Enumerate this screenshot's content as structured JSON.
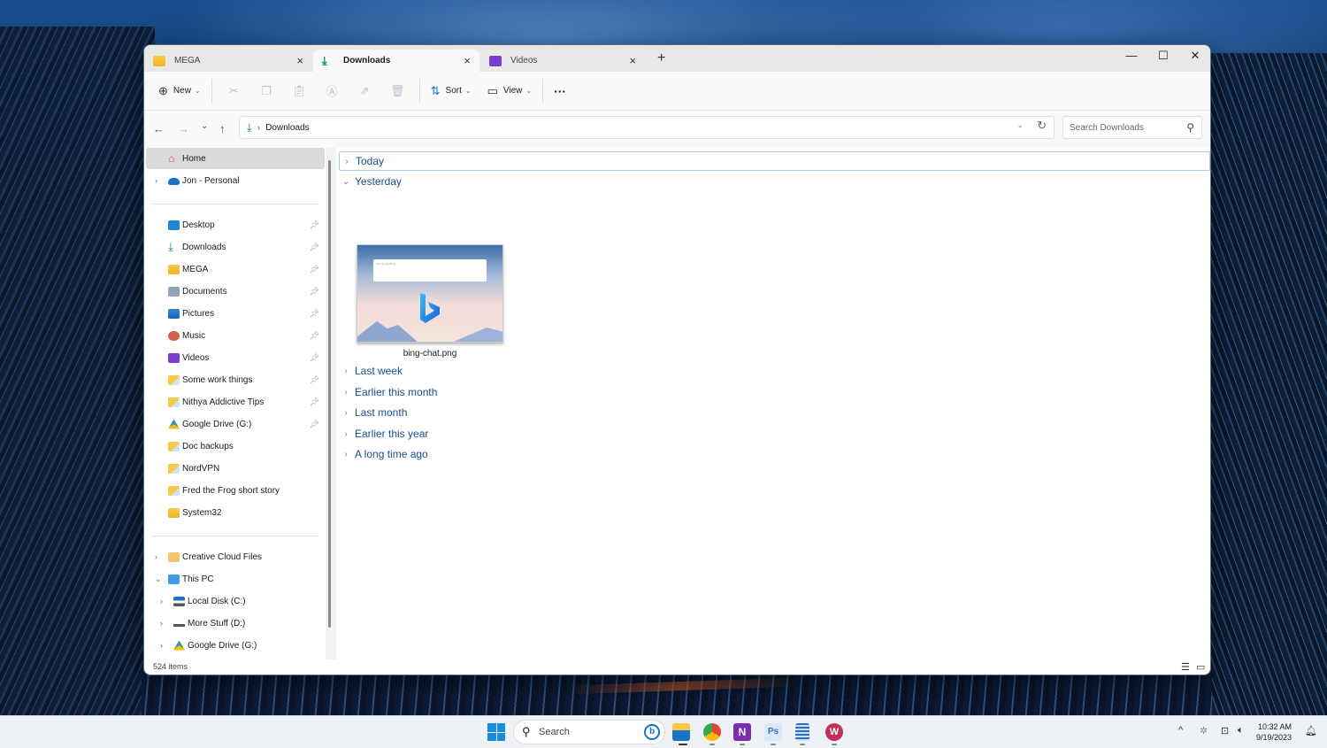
{
  "window": {
    "tabs": [
      {
        "label": "MEGA",
        "icon": "folder-icon",
        "active": false
      },
      {
        "label": "Downloads",
        "icon": "download-icon",
        "active": true
      },
      {
        "label": "Videos",
        "icon": "videos-icon",
        "active": false
      }
    ],
    "new_tab": "+",
    "controls": {
      "minimize": "—",
      "maximize": "☐",
      "close": "✕"
    }
  },
  "toolbar": {
    "new_label": "New",
    "sort_label": "Sort",
    "view_label": "View",
    "more_label": "···",
    "icons": [
      "cut-icon",
      "copy-icon",
      "paste-icon",
      "rename-icon",
      "share-icon",
      "delete-icon"
    ]
  },
  "nav": {
    "back": "←",
    "forward": "→",
    "recent": "⌄",
    "up": "↑",
    "breadcrumb": [
      "Downloads"
    ],
    "search_placeholder": "Search Downloads"
  },
  "sidebar": {
    "top": [
      {
        "label": "Home",
        "icon": "home-icon",
        "selected": true
      },
      {
        "label": "Jon - Personal",
        "icon": "onedrive-icon",
        "expandable": true
      }
    ],
    "quick_access": [
      {
        "label": "Desktop",
        "icon": "desktop-icon",
        "pinned": true
      },
      {
        "label": "Downloads",
        "icon": "download-icon",
        "pinned": true
      },
      {
        "label": "MEGA",
        "icon": "folder-icon",
        "pinned": true
      },
      {
        "label": "Documents",
        "icon": "documents-icon",
        "pinned": true
      },
      {
        "label": "Pictures",
        "icon": "pictures-icon",
        "pinned": true
      },
      {
        "label": "Music",
        "icon": "music-icon",
        "pinned": true
      },
      {
        "label": "Videos",
        "icon": "videos-icon",
        "pinned": true
      },
      {
        "label": "Some work things",
        "icon": "cloud-folder-icon",
        "pinned": true
      },
      {
        "label": "Nithya Addictive Tips",
        "icon": "cloud-folder-icon",
        "pinned": true
      },
      {
        "label": "Google Drive (G:)",
        "icon": "google-drive-icon",
        "pinned": true
      },
      {
        "label": "Doc backups",
        "icon": "cloud-folder-icon",
        "pinned": false
      },
      {
        "label": "NordVPN",
        "icon": "cloud-folder-icon",
        "pinned": false
      },
      {
        "label": "Fred the Frog short story",
        "icon": "cloud-folder-icon",
        "pinned": false
      },
      {
        "label": "System32",
        "icon": "folder-icon",
        "pinned": false
      }
    ],
    "bottom": [
      {
        "label": "Creative Cloud Files",
        "icon": "creative-cloud-icon",
        "expand": "›",
        "level": 0
      },
      {
        "label": "This PC",
        "icon": "this-pc-icon",
        "expand": "⌄",
        "level": 0
      },
      {
        "label": "Local Disk (C:)",
        "icon": "local-disk-icon",
        "expand": "›",
        "level": 1
      },
      {
        "label": "More Stuff (D:)",
        "icon": "drive-icon",
        "expand": "›",
        "level": 1
      },
      {
        "label": "Google Drive (G:)",
        "icon": "google-drive-icon",
        "expand": "›",
        "level": 1
      }
    ]
  },
  "content": {
    "groups": [
      {
        "label": "Today",
        "expanded": false
      },
      {
        "label": "Yesterday",
        "expanded": true
      },
      {
        "label": "Last week",
        "expanded": false
      },
      {
        "label": "Earlier this month",
        "expanded": false
      },
      {
        "label": "Last month",
        "expanded": false
      },
      {
        "label": "Earlier this year",
        "expanded": false
      },
      {
        "label": "A long time ago",
        "expanded": false
      }
    ],
    "files": [
      {
        "name": "bing-chat.png",
        "thumb_text": "Ask me anything..."
      }
    ]
  },
  "status": {
    "item_count": "524 items"
  },
  "taskbar": {
    "search_label": "Search",
    "apps": [
      "start-icon",
      "file-explorer-icon",
      "chrome-icon",
      "onenote-icon",
      "photoshop-icon",
      "notepad-icon",
      "wps-icon"
    ],
    "time": "10:32 AM",
    "date": "9/19/2023"
  }
}
